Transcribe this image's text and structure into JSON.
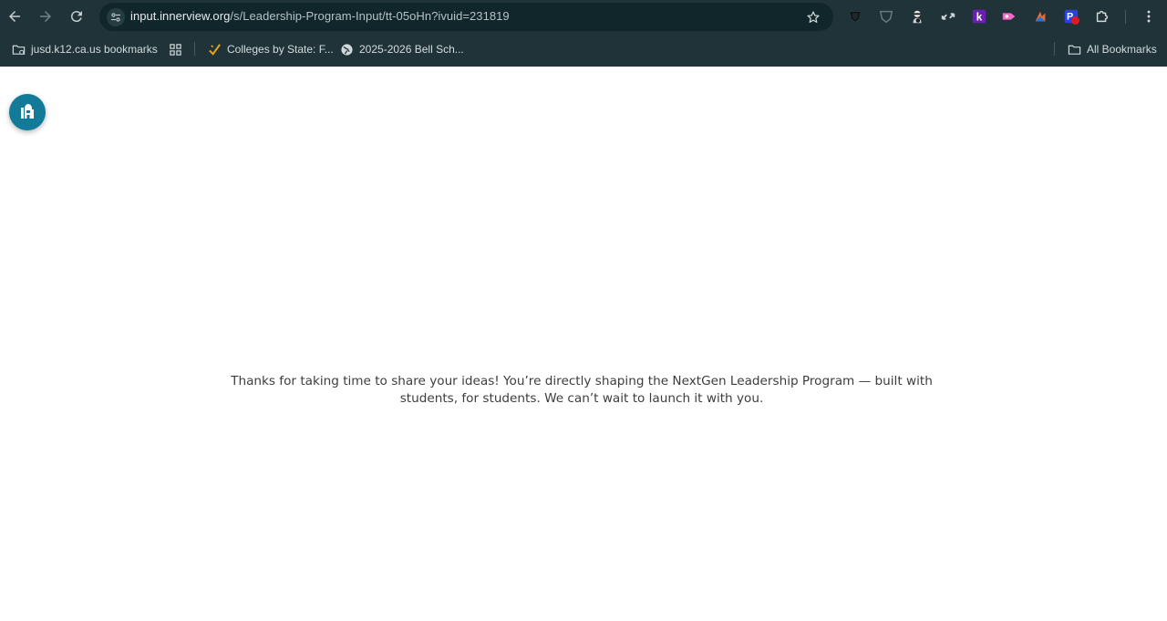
{
  "browser": {
    "url_host": "input.innerview.org",
    "url_path": "/s/Leadership-Program-Input/tt-05oHn?ivuid=231819",
    "extensions": [
      "shield-icon",
      "shield-outline-icon",
      "ninja-icon",
      "arrows-icon",
      "k-extension-icon",
      "pink-tag-icon",
      "orange-chart-icon",
      "blue-p-extension-icon",
      "puzzle-icon"
    ]
  },
  "bookmarks": {
    "items": [
      {
        "label": "jusd.k12.ca.us bookmarks",
        "icon": "managed-folder-icon"
      },
      {
        "label": "",
        "icon": "apps-grid-icon"
      },
      {
        "label": "Colleges by State: F...",
        "icon": "check-badge-icon"
      },
      {
        "label": "2025-2026 Bell Sch...",
        "icon": "globe-icon"
      }
    ],
    "all_label": "All Bookmarks"
  },
  "page": {
    "message": "Thanks for taking  time to share your ideas! You’re directly shaping the NextGen Leadership Program — built with students, for students. We can’t wait to launch it with you."
  },
  "colors": {
    "chrome_bg": "#1f3338",
    "omnibox_bg": "#10262b",
    "fab": "#137a97",
    "text": "#3d3d3d"
  }
}
